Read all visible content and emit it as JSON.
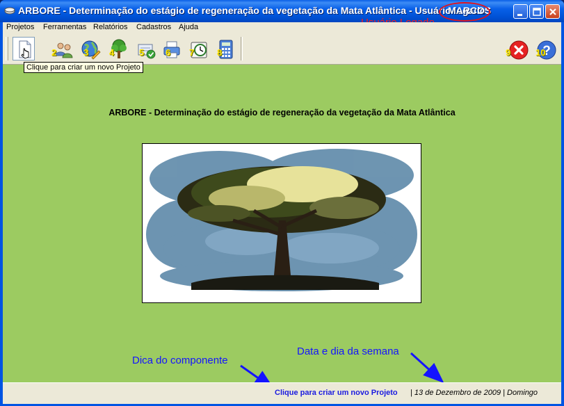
{
  "window": {
    "title": "ARBORE - Determinação do estágio de regeneração da vegetação da Mata Atlântica - Usuário logado:",
    "user": "MARCOS",
    "user_annotation": "Usuário Logado"
  },
  "menu": [
    {
      "label": "Projetos"
    },
    {
      "label": "Ferramentas"
    },
    {
      "label": "Relatórios"
    },
    {
      "label": "Cadastros"
    },
    {
      "label": "Ajuda"
    }
  ],
  "toolbar": {
    "buttons": [
      {
        "number": "",
        "icon": "new-project-icon"
      },
      {
        "number": "2",
        "icon": "users-icon"
      },
      {
        "number": "3",
        "icon": "globe-tools-icon"
      },
      {
        "number": "4",
        "icon": "tree-icon"
      },
      {
        "number": "5",
        "icon": "check-document-icon"
      },
      {
        "number": "6",
        "icon": "printer-icon"
      },
      {
        "number": "7",
        "icon": "clock-icon"
      },
      {
        "number": "8",
        "icon": "calculator-icon"
      },
      {
        "number": "9",
        "icon": "exit-icon"
      },
      {
        "number": "10",
        "icon": "help-icon"
      }
    ],
    "tooltip": "Clique para criar um novo Projeto"
  },
  "main": {
    "heading": "ARBORE - Determinação do estágio de regeneração da vegetação da Mata Atlântica",
    "annotations": {
      "hint": "Dica do componente",
      "date": "Data e dia da semana"
    }
  },
  "status": {
    "hint": "Clique para criar um novo Projeto",
    "date": "| 13 de Dezembro de 2009 | Domingo"
  },
  "colors": {
    "background": "#9ccb61",
    "title_bar": "#0054e3",
    "annotation_red": "#ff1a1a",
    "annotation_blue": "#1414ff"
  }
}
